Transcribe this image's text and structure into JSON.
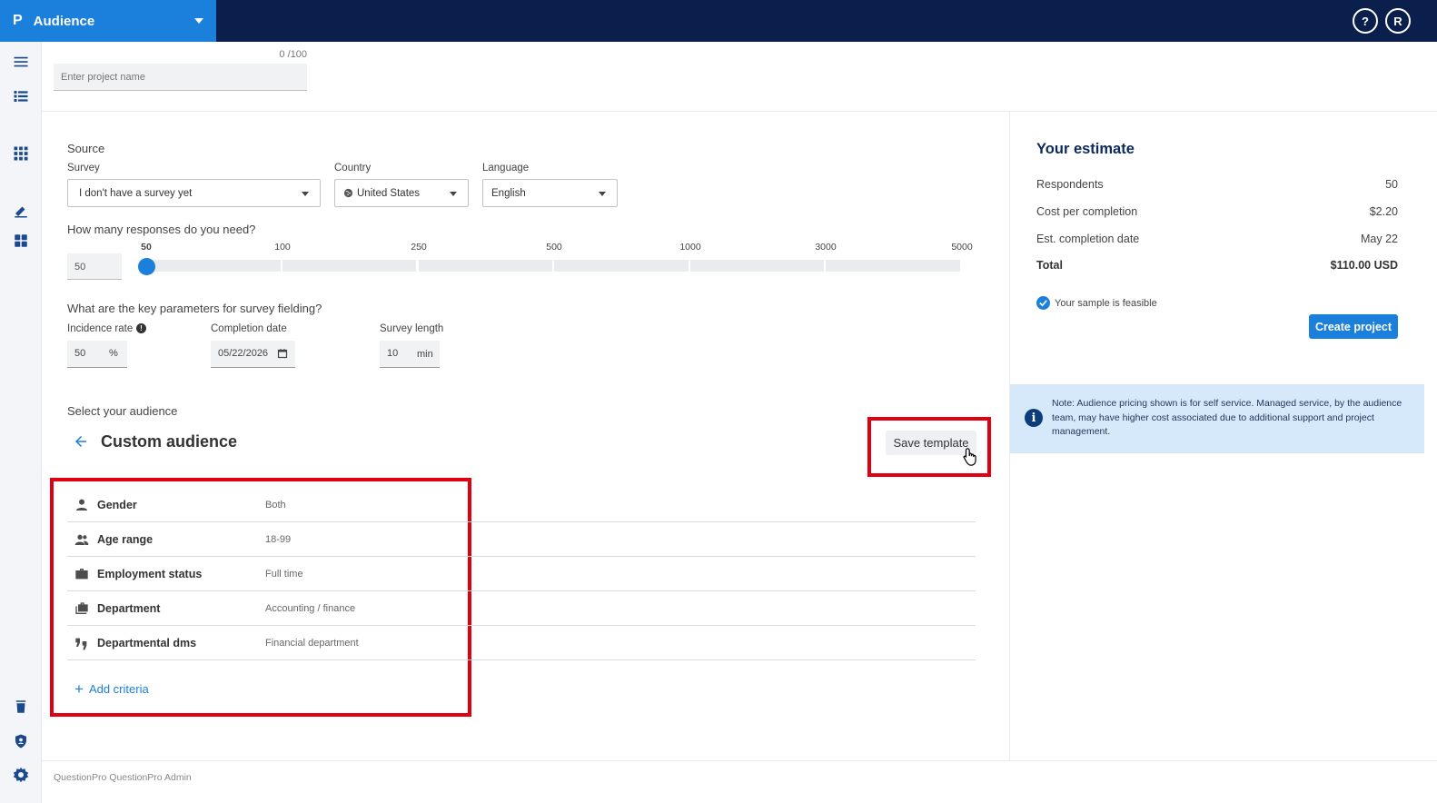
{
  "header": {
    "logo": "P",
    "app_title": "Audience",
    "help_label": "?",
    "user_initial": "R"
  },
  "project": {
    "char_count": "0 /100",
    "name_placeholder": "Enter project name"
  },
  "source": {
    "heading": "Source",
    "survey_label": "Survey",
    "survey_value": "I don't have a survey yet",
    "country_label": "Country",
    "country_value": "United States",
    "language_label": "Language",
    "language_value": "English"
  },
  "responses": {
    "question": "How many responses do you need?",
    "value": "50",
    "ticks": [
      "50",
      "100",
      "250",
      "500",
      "1000",
      "3000",
      "5000"
    ],
    "selected": "50"
  },
  "parameters": {
    "question": "What are the key parameters for survey fielding?",
    "incidence_label": "Incidence rate",
    "incidence_value": "50",
    "incidence_unit": "%",
    "completion_label": "Completion date",
    "completion_value": "05/22/2026",
    "length_label": "Survey length",
    "length_value": "10",
    "length_unit": "min"
  },
  "audience": {
    "select_label": "Select your audience",
    "title": "Custom audience",
    "save_template": "Save template",
    "criteria": [
      {
        "name": "Gender",
        "value": "Both",
        "icon": "person-icon"
      },
      {
        "name": "Age range",
        "value": "18-99",
        "icon": "people-icon"
      },
      {
        "name": "Employment status",
        "value": "Full time",
        "icon": "briefcase-icon"
      },
      {
        "name": "Department",
        "value": "Accounting / finance",
        "icon": "briefcase-stack-icon"
      },
      {
        "name": "Departmental dms",
        "value": "Financial department",
        "icon": "quote-icon"
      }
    ],
    "add_criteria": "Add criteria"
  },
  "estimate": {
    "title": "Your estimate",
    "respondents_label": "Respondents",
    "respondents_value": "50",
    "cpc_label": "Cost per completion",
    "cpc_value": "$2.20",
    "date_label": "Est. completion date",
    "date_value": "May 22",
    "total_label": "Total",
    "total_value": "$110.00 USD",
    "feasible_text": "Your sample is feasible",
    "create_button": "Create project"
  },
  "note": {
    "text": "Note: Audience pricing shown is for self service. Managed service, by the audience team, may have higher cost associated due to additional support and project management."
  },
  "footer": {
    "text": "QuestionPro QuestionPro Admin"
  },
  "colors": {
    "topbar": "#0b1f4d",
    "accent": "#1b7fdc",
    "highlight": "#e00012",
    "note_bg": "#d6e9fb"
  }
}
